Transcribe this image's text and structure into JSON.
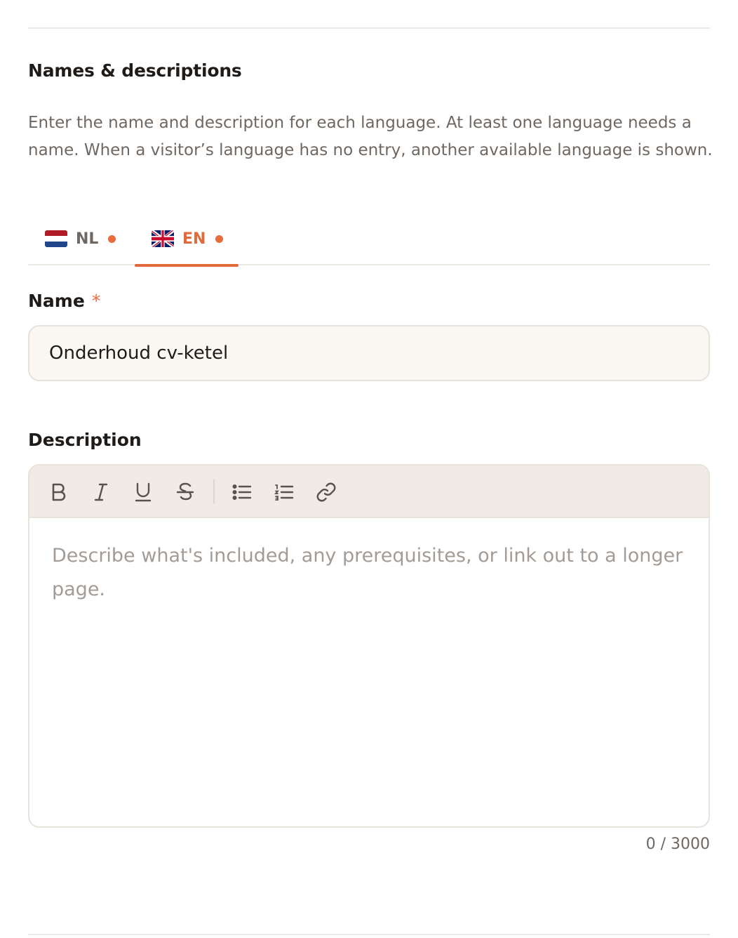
{
  "section": {
    "title": "Names & descriptions",
    "description": "Enter the name and description for each language. At least one language needs a name. When a visitor’s language has no entry, another available language is shown."
  },
  "tabs": [
    {
      "code": "NL",
      "flag": "netherlands-flag-icon",
      "active": false
    },
    {
      "code": "EN",
      "flag": "uk-flag-icon",
      "active": true
    }
  ],
  "name_field": {
    "label": "Name",
    "required_marker": "*",
    "value": "Onderhoud cv-ketel"
  },
  "description_field": {
    "label": "Description",
    "placeholder": "Describe what's included, any prerequisites, or link out to a longer page.",
    "toolbar": [
      "bold-icon",
      "italic-icon",
      "underline-icon",
      "strikethrough-icon",
      "bullet-list-icon",
      "numbered-list-icon",
      "link-icon"
    ],
    "counter": "0 / 3000"
  },
  "colors": {
    "accent": "#e06a3a",
    "dot": "#e86b3c",
    "input_bg": "#faf7f3",
    "toolbar_bg": "#f0ebe5"
  }
}
